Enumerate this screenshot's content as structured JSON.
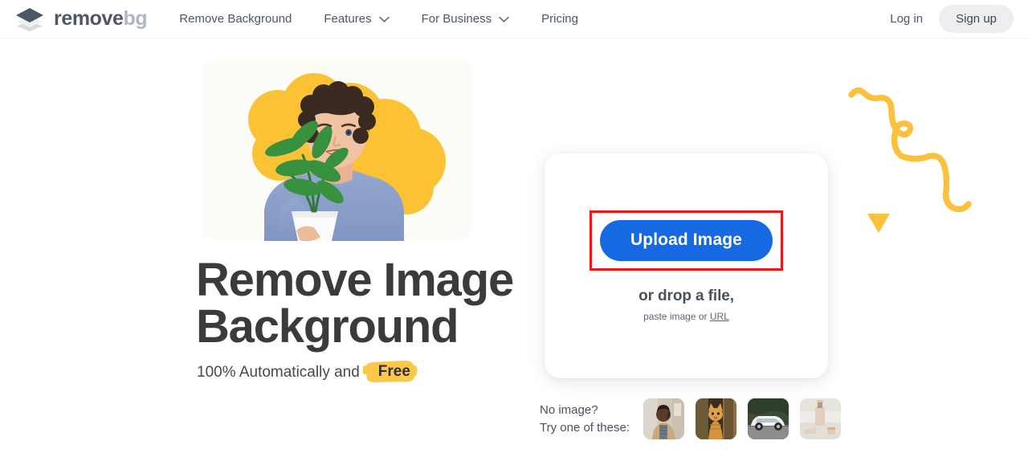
{
  "header": {
    "logo": {
      "icon": "layers-icon",
      "name_main": "remove",
      "name_suffix": "bg"
    },
    "nav": [
      {
        "label": "Remove Background",
        "has_chevron": false
      },
      {
        "label": "Features",
        "has_chevron": true
      },
      {
        "label": "For Business",
        "has_chevron": true
      },
      {
        "label": "Pricing",
        "has_chevron": false
      }
    ],
    "login_label": "Log in",
    "signup_label": "Sign up"
  },
  "hero": {
    "title_line1": "Remove Image",
    "title_line2": "Background",
    "subtitle_text": "100% Automatically and",
    "subtitle_badge": "Free",
    "photo_alt": "man holding potted plant on yellow blob background"
  },
  "upload": {
    "button_label": "Upload Image",
    "drop_text": "or drop a file,",
    "paste_prefix": "paste image or",
    "paste_link": "URL",
    "highlight_color": "#f71414",
    "button_color": "#1668e3"
  },
  "samples": {
    "label_line1": "No image?",
    "label_line2": "Try one of these:",
    "thumbnails": [
      {
        "name": "sample-person",
        "alt": "man on phone"
      },
      {
        "name": "sample-cat",
        "alt": "orange cat by tree"
      },
      {
        "name": "sample-car",
        "alt": "white hatchback car"
      },
      {
        "name": "sample-product",
        "alt": "cosmetic bottle product"
      }
    ]
  },
  "decor": {
    "squiggle_color": "#fbc03c",
    "triangle_color": "#fbc03c"
  },
  "colors": {
    "accent_yellow": "#fbc84a",
    "brand_blue": "#1668e3",
    "text_dark": "#3b3b3b",
    "text_muted": "#4c5866",
    "highlight_red": "#f71414"
  }
}
